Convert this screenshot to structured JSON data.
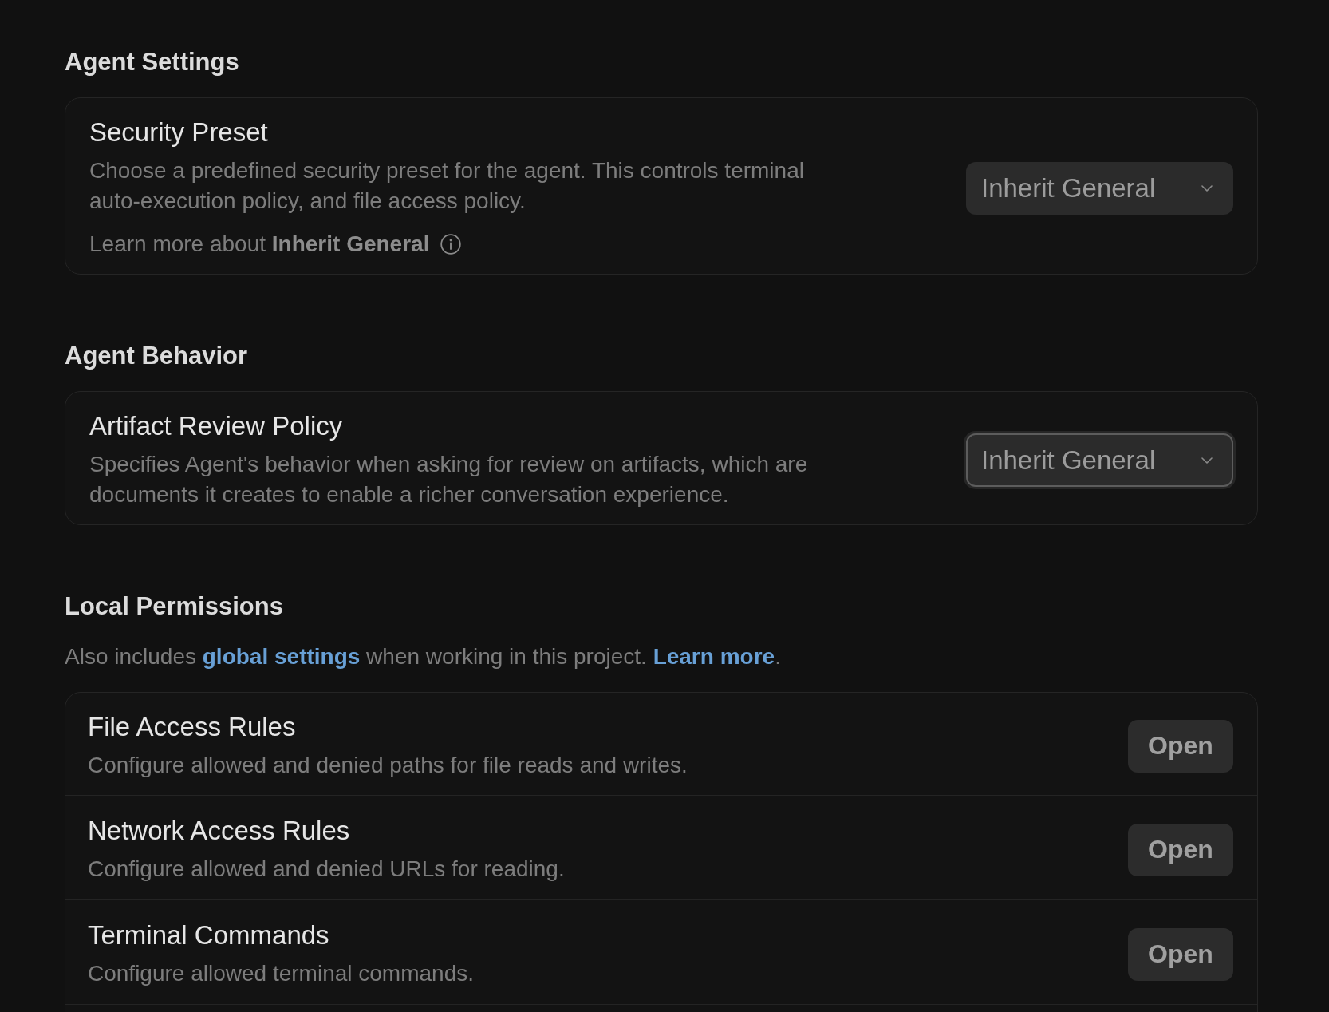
{
  "sections": [
    {
      "kind": "setting",
      "heading": "Agent Settings",
      "setting": {
        "title": "Security Preset",
        "description": "Choose a predefined security preset for the agent. This controls terminal auto-execution policy, and file access policy.",
        "note": "Learn more about **Inherit General**",
        "dropdown": {
          "value": "Inherit General",
          "focused": false
        }
      }
    },
    {
      "kind": "setting",
      "heading": "Agent Behavior",
      "setting": {
        "title": "Artifact Review Policy",
        "description": "Specifies Agent's behavior when asking for review on artifacts, which are documents it creates to enable a richer conversation experience.",
        "dropdown": {
          "value": "Inherit General",
          "focused": true
        }
      }
    },
    {
      "kind": "rules",
      "heading": "Local Permissions",
      "intro": [
        {
          "kind": "text",
          "text": "Also includes "
        },
        {
          "kind": "link",
          "text": "global settings"
        },
        {
          "kind": "text",
          "text": " when working in this project. "
        },
        {
          "kind": "link",
          "text": "Learn more"
        },
        {
          "kind": "text",
          "text": "."
        }
      ],
      "rules": [
        {
          "title": "File Access Rules",
          "description": "Configure allowed and denied paths for file reads and writes.",
          "button": "Open"
        },
        {
          "title": "Network Access Rules",
          "description": "Configure allowed and denied URLs for reading.",
          "button": "Open"
        },
        {
          "title": "Terminal Commands",
          "description": "Configure allowed terminal commands.",
          "button": "Open"
        }
      ]
    }
  ]
}
